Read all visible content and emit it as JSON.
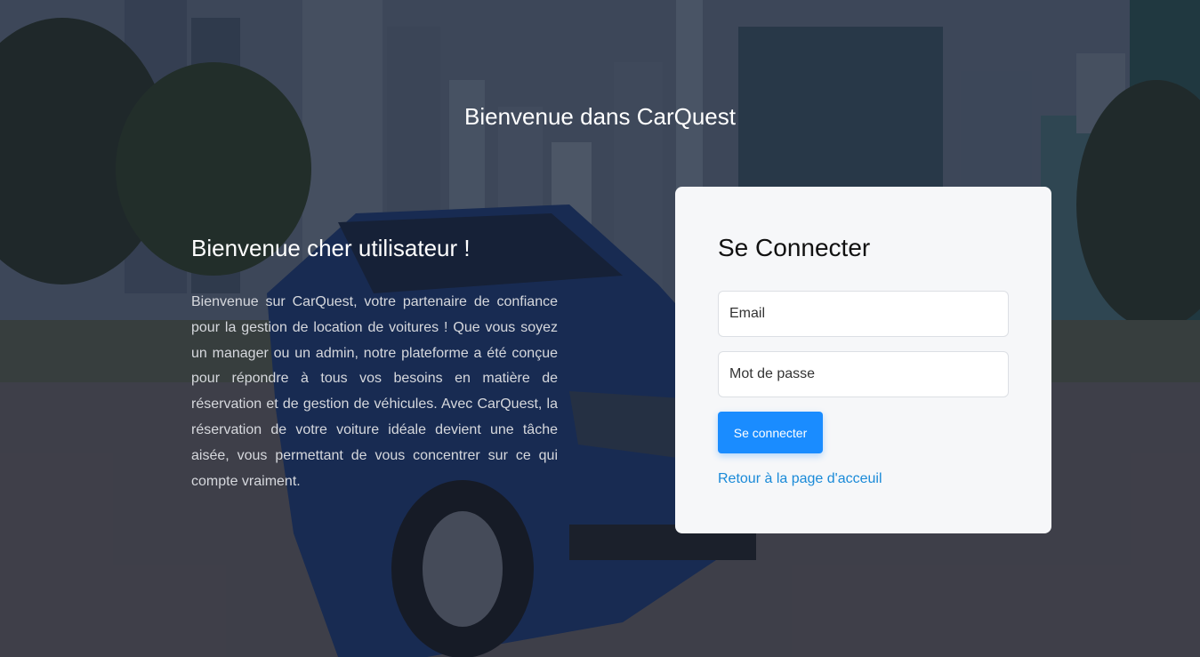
{
  "app": {
    "title": "Bienvenue dans CarQuest"
  },
  "intro": {
    "heading": "Bienvenue cher utilisateur !",
    "body": "Bienvenue sur CarQuest, votre partenaire de confiance pour la gestion de location de voitures ! Que vous soyez un manager ou un admin, notre plateforme a été conçue pour répondre à tous vos besoins en matière de réservation et de gestion de véhicules. Avec CarQuest, la réservation de votre voiture idéale devient une tâche aisée, vous permettant de vous concentrer sur ce qui compte vraiment."
  },
  "login": {
    "heading": "Se Connecter",
    "email_placeholder": "Email",
    "password_placeholder": "Mot de passe",
    "submit_label": "Se connecter",
    "back_link": "Retour à la page d'acceuil"
  },
  "colors": {
    "accent": "#1a8cff",
    "link": "#1a8ad8",
    "card_bg": "#f6f7f9"
  }
}
